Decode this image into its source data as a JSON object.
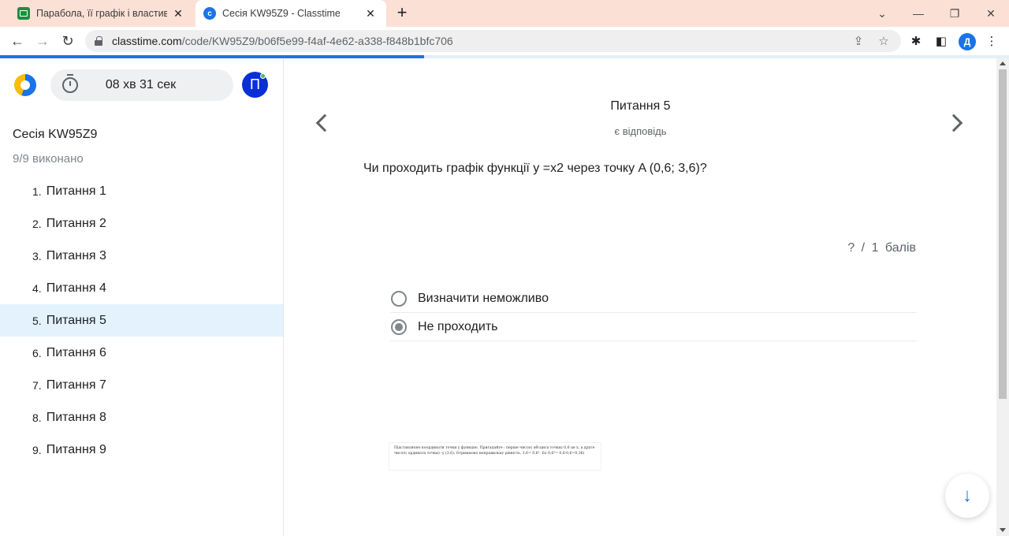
{
  "browser": {
    "tabs": [
      {
        "title": "Парабола, її графік і властивості",
        "active": false
      },
      {
        "title": "Сесія KW95Z9 - Classtime",
        "active": true
      }
    ],
    "url_host": "classtime.com",
    "url_path": "/code/KW95Z9/b06f5e99-f4af-4e62-a338-f848b1bfc706",
    "profile_initial": "Д",
    "new_tab_label": "+",
    "close_glyph": "✕"
  },
  "session": {
    "timer": "08 хв 31 сек",
    "avatar_initial": "П",
    "title": "Сесія KW95Z9",
    "progress_text": "9/9 виконано",
    "progress_fraction": 0.42
  },
  "sidebar": {
    "items": [
      {
        "num": "1.",
        "label": "Питання 1"
      },
      {
        "num": "2.",
        "label": "Питання 2"
      },
      {
        "num": "3.",
        "label": "Питання 3"
      },
      {
        "num": "4.",
        "label": "Питання 4"
      },
      {
        "num": "5.",
        "label": "Питання 5"
      },
      {
        "num": "6.",
        "label": "Питання 6"
      },
      {
        "num": "7.",
        "label": "Питання 7"
      },
      {
        "num": "8.",
        "label": "Питання 8"
      },
      {
        "num": "9.",
        "label": "Питання 9"
      }
    ],
    "active_index": 4
  },
  "question": {
    "title": "Питання 5",
    "status": "є відповідь",
    "text": "Чи проходить графік функції y =x2 через точку A (0,6; 3,6)?",
    "points": "? / 1 балів",
    "options": [
      {
        "label": "Визначити неможливо",
        "selected": false
      },
      {
        "label": "Не проходить",
        "selected": true
      }
    ],
    "hint_text": "Підставляємо координати точки у функцію. Пригадайте : перше число( абсциса точки) 0,6 це х, а друге число( ордината точки) -у (3,6). Отримаємо неправильну рівність. 3,6= 0,6². Бо 0,6²= 0,6·0,6=0,36)"
  },
  "colors": {
    "accent": "#1a73e8",
    "active_row": "#e3f2fd",
    "avatar": "#0b2fd6",
    "tabbar": "#fbe0d6"
  }
}
